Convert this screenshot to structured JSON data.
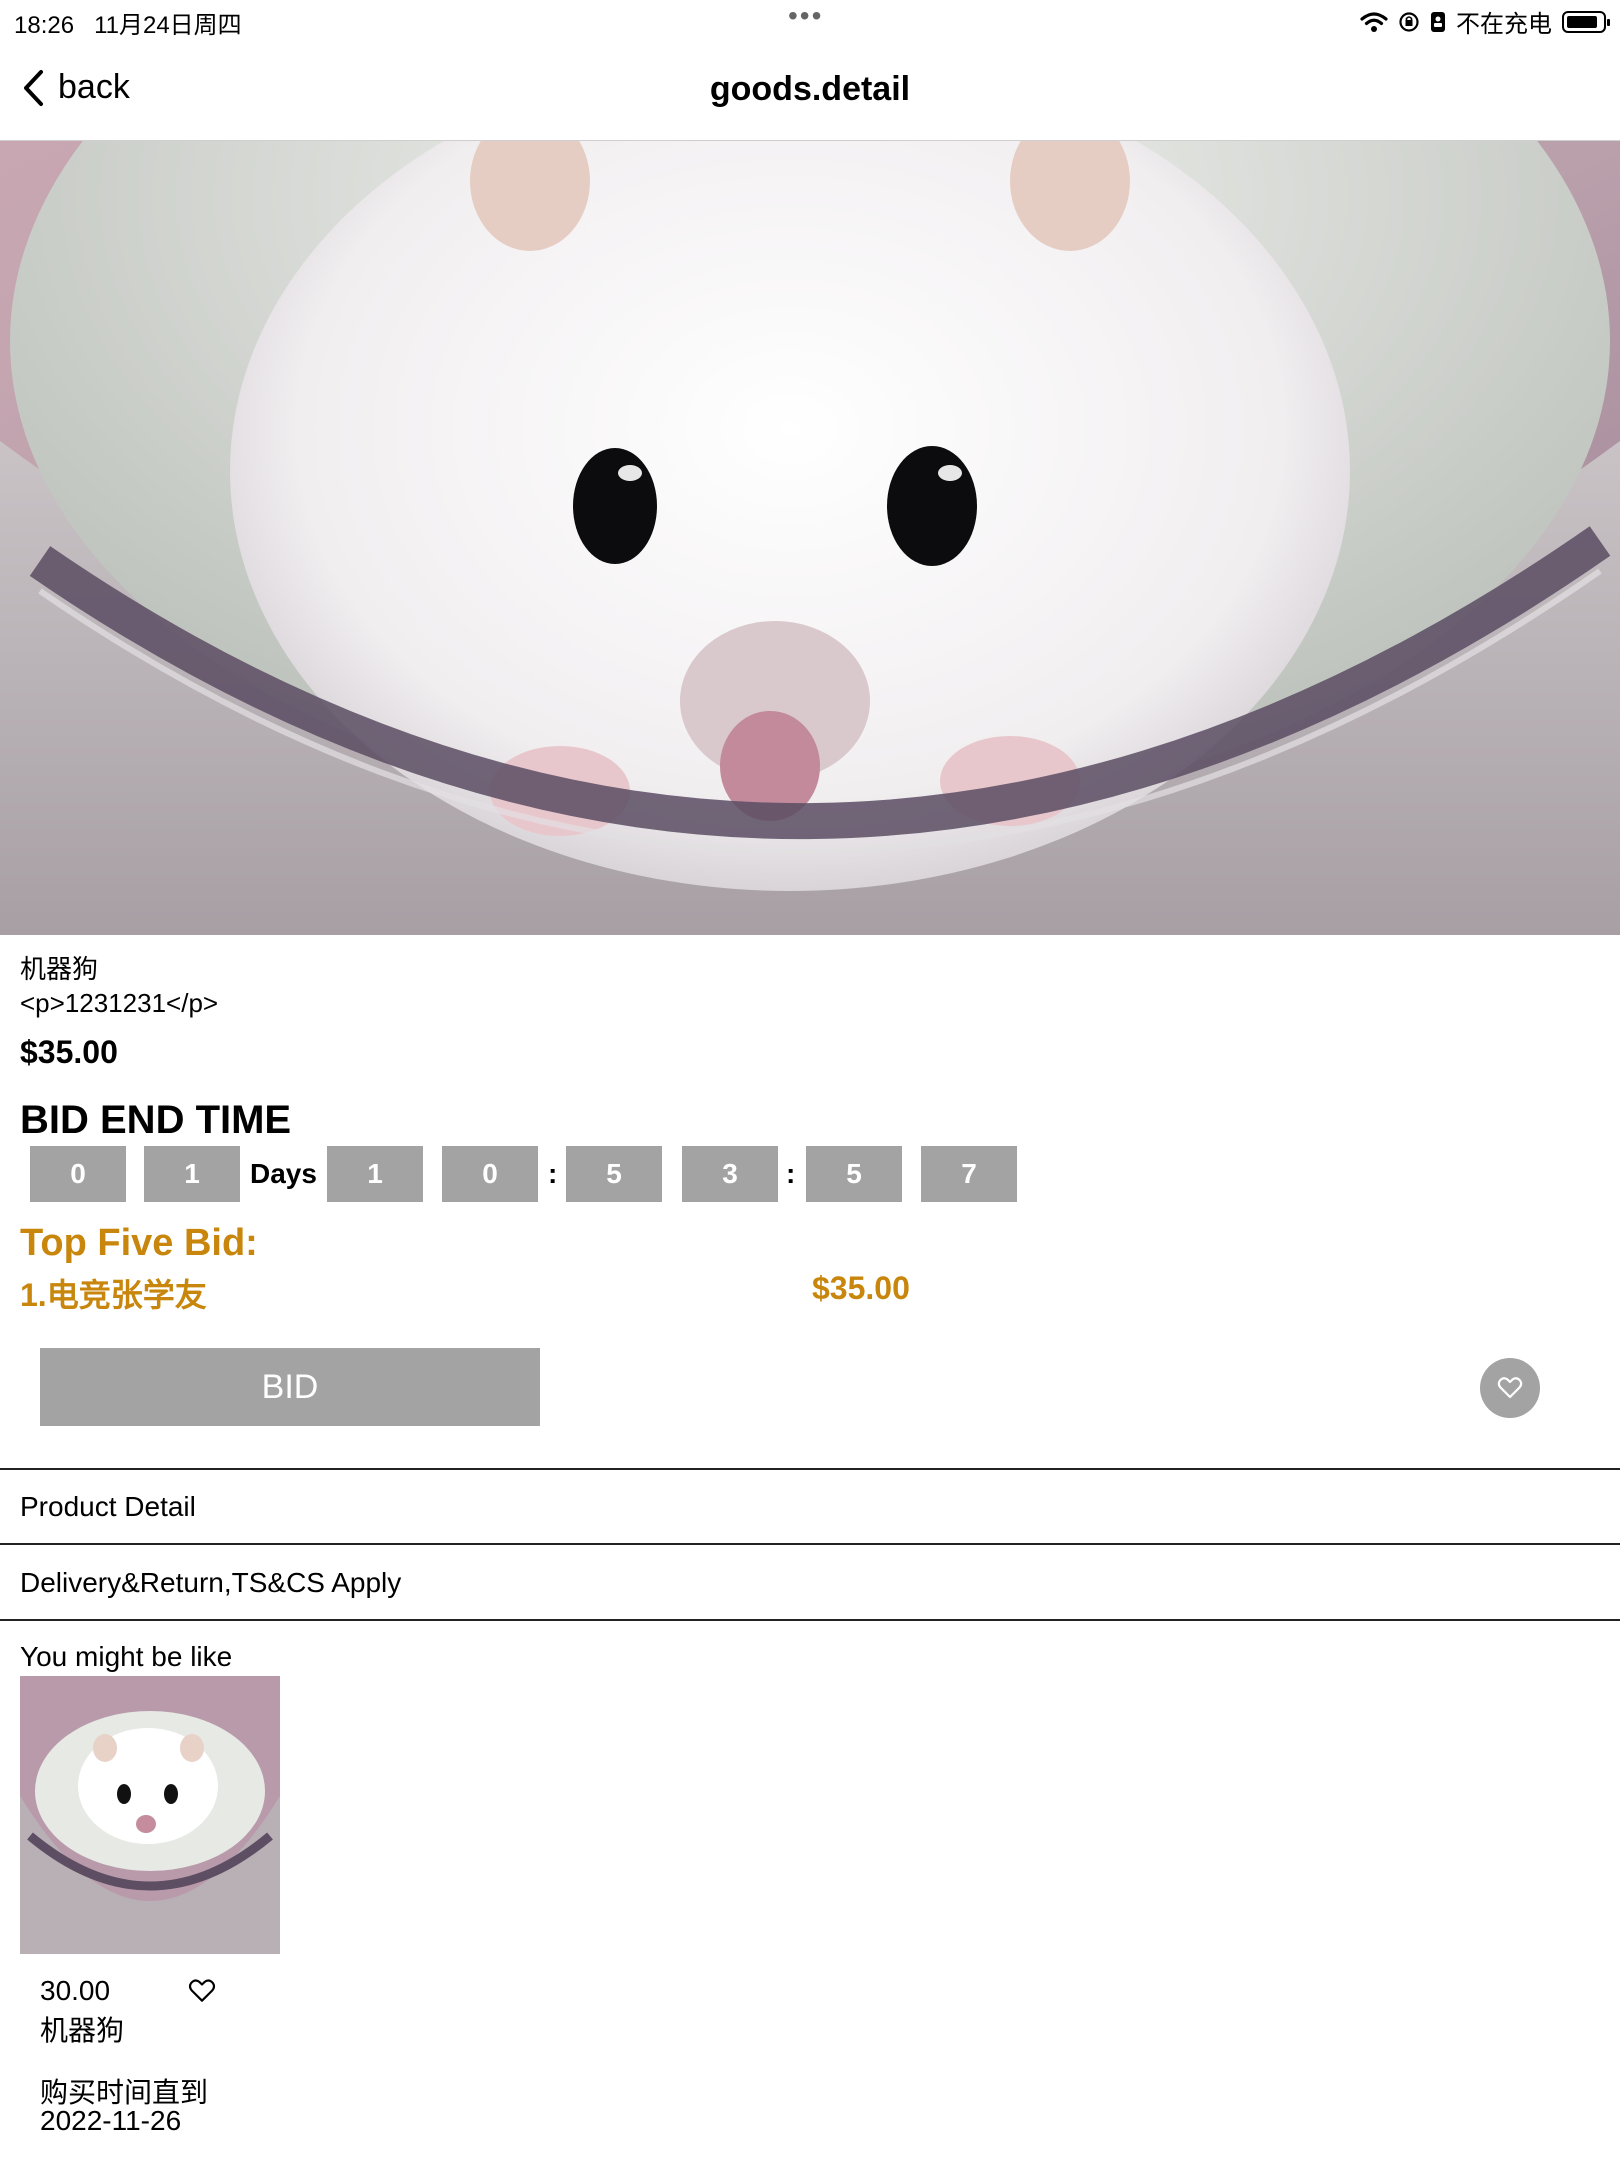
{
  "status_bar": {
    "time": "18:26",
    "date": "11月24日周四",
    "dots": "•••",
    "charging": "不在充电"
  },
  "nav": {
    "back_label": "back",
    "title": "goods.detail"
  },
  "product": {
    "name": "机器狗",
    "description": "<p>1231231</p>",
    "price": "$35.00"
  },
  "bid_end": {
    "title": "BID END TIME",
    "days_label": "Days",
    "digits": [
      "0",
      "1",
      "1",
      "0",
      "5",
      "3",
      "5",
      "7"
    ],
    "separator": ":"
  },
  "top_bids": {
    "title": "Top Five Bid:",
    "entries": [
      {
        "label": "1.电竞张学友",
        "amount": "$35.00"
      }
    ]
  },
  "actions": {
    "bid_label": "BID"
  },
  "sections": {
    "product_detail": "Product Detail",
    "delivery": "Delivery&Return,TS&CS Apply"
  },
  "suggestions": {
    "title": "You might be like",
    "items": [
      {
        "price": "30.00",
        "name": "机器狗",
        "until_label": "购买时间直到",
        "until_date": "2022-11-26"
      }
    ]
  },
  "colors": {
    "accent_gold": "#c8860d",
    "grey_box": "#a3a3a3"
  }
}
